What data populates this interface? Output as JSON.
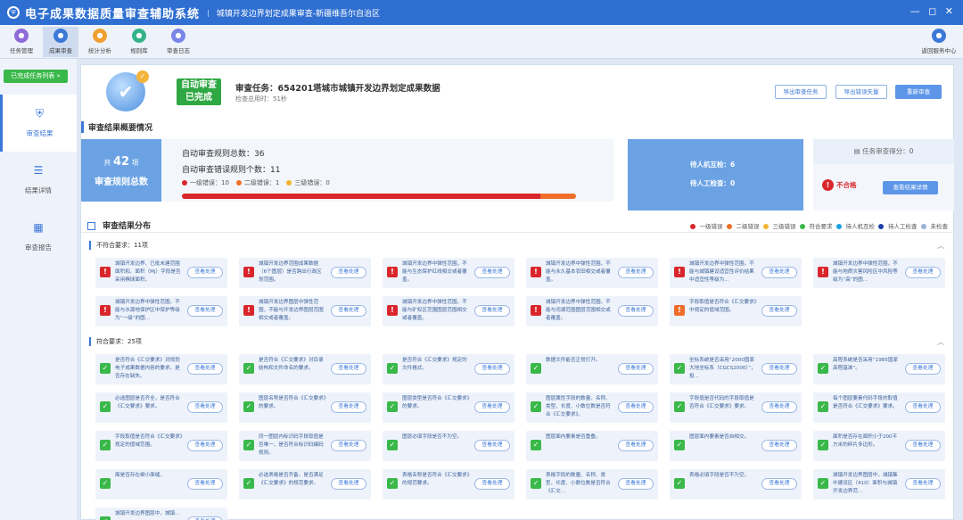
{
  "app": {
    "title": "电子成果数据质量审查辅助系统",
    "separator": "|",
    "subtitle": "城镇开发边界划定成果审查-新疆维吾尔自治区",
    "window_controls": "— ◻ ✕"
  },
  "toolbar": {
    "items": [
      {
        "label": "任务管理",
        "icon": "task-icon",
        "color": "#8e6bd8"
      },
      {
        "label": "成果审查",
        "icon": "review-icon",
        "color": "#3b78d8"
      },
      {
        "label": "统计分析",
        "icon": "stats-icon",
        "color": "#f0a030"
      },
      {
        "label": "规则库",
        "icon": "rules-icon",
        "color": "#34b38a"
      },
      {
        "label": "审查日志",
        "icon": "log-icon",
        "color": "#7a85e8"
      }
    ],
    "right_label": "返回服务中心",
    "active_index": 1
  },
  "sidebar": {
    "back_button": "已完成任务列表 »",
    "items": [
      {
        "label": "审查结果",
        "icon": "shield-icon"
      },
      {
        "label": "结果详情",
        "icon": "list-icon"
      },
      {
        "label": "审查报告",
        "icon": "report-icon"
      }
    ],
    "active_index": 0
  },
  "header": {
    "status_line1": "自动审查",
    "status_line2": "已完成",
    "task_label": "审查任务：",
    "task_name": "654201塔城市城镇开发边界划定成果数据",
    "elapsed": "检查总用时：51秒",
    "buttons": [
      "导出审查任务",
      "导出错误矢量",
      "重新审查"
    ]
  },
  "summary": {
    "section_title": "审查结果概要情况",
    "total_prefix": "共",
    "total_count": "42",
    "total_unit": "项",
    "total_label": "审查规则总数",
    "auto_rules_label": "自动审查规则总数：",
    "auto_rules_count": "36",
    "error_rules_label": "自动审查错误规则个数：",
    "error_rules_count": "11",
    "levels": [
      {
        "label": "一级错误：",
        "count": "10",
        "color": "#d9262c"
      },
      {
        "label": "二级错误：",
        "count": "1",
        "color": "#f06e2a"
      },
      {
        "label": "三级错误：",
        "count": "0",
        "color": "#f2b430"
      }
    ],
    "bar_fraction": {
      "level1": 0.91,
      "level2": 0.09
    },
    "machine_check_label": "待人机互检：",
    "machine_check_value": "6",
    "manual_check_label": "待人工检查：",
    "manual_check_value": "0",
    "score_label": "任务审查得分：",
    "score_value": "0",
    "result": "不合格",
    "detail_button": "查看结果详情"
  },
  "distribution": {
    "title": "审查结果分布",
    "legend": [
      {
        "label": "一级错误",
        "color": "#d9262c"
      },
      {
        "label": "二级错误",
        "color": "#f06e2a"
      },
      {
        "label": "三级错误",
        "color": "#f2b430"
      },
      {
        "label": "符合要求",
        "color": "#3ab84a"
      },
      {
        "label": "待人机互检",
        "color": "#1aa0e0"
      },
      {
        "label": "待人工检查",
        "color": "#1b3ea6"
      },
      {
        "label": "未检查",
        "color": "#9bb3d6"
      }
    ],
    "group_fail": "不符合要求：11项",
    "group_pass": "符合要求：25项",
    "check_button": "查看处理",
    "fail_cards": [
      {
        "text": "城镇开发边界、已批未建范围面积和、面积（Mj）字段是否采用椭球面积。",
        "color": "#d9262c"
      },
      {
        "text": "城镇开发边界范围成果数据（6个图层）是否跨出行政区划范围。",
        "color": "#d9262c"
      },
      {
        "text": "城镇开发边界中弹性范围，不能与生态保护红线相交或者覆盖。",
        "color": "#d9262c"
      },
      {
        "text": "城镇开发边界中弹性范围，不能与永久基本农田相交或者覆盖。",
        "color": "#d9262c"
      },
      {
        "text": "城镇开发边界中弹性范围，不能与城镇建设适宜性评价结果中适宜性等级为...",
        "color": "#d9262c"
      },
      {
        "text": "城镇开发边界中弹性范围，不能与地质灾害风险区中风险等级为“高”的图...",
        "color": "#d9262c"
      },
      {
        "text": "城镇开发边界中弹性范围，不能与水源地保护区中保护等级为“一级”的图...",
        "color": "#d9262c"
      },
      {
        "text": "城镇开发边界图层中弹性范围，不能与开发边界图层范围相交或者覆盖。",
        "color": "#d9262c"
      },
      {
        "text": "城镇开发边界中弹性范围，不能与矿权区范围图层范围相交或者覆盖。",
        "color": "#d9262c"
      },
      {
        "text": "城镇开发边界中弹性范围，不能与河湖范围图层范围相交或者覆盖。",
        "color": "#d9262c"
      },
      {
        "text": "字段取值是否符合《汇交要求》中规定的值域范围。",
        "color": "#f06e2a"
      }
    ],
    "pass_cards": [
      "是否符合《汇交要求》对规划电子成果数据内容的要求，是否存在缺失。",
      "是否符合《汇交要求》对目录结构和文件命名的要求。",
      "是否符合《汇交要求》规定的文件格式。",
      "数据文件能否正常打开。",
      "坐标系统是否采用“2000国家大地坐标系（CGCS2000）”，投...",
      "高程系统是否采用“1985国家高程基准”。",
      "必选图层是否齐全，是否符合《汇交要求》要求。",
      "图层名称是否符合《汇交要求》的要求。",
      "图层类型是否符合《汇交要求》的要求。",
      "图层属性字段的数量、名称、类型、长度、小数位数是否符合《汇交要求》。",
      "字段值是否代码的字段取值是否符合《汇交要求》要求。",
      "每个图层要素代码字段的取值是否符合《汇交要求》要求。",
      "字段取值是否符合《汇交要求》规定的值域范围。",
      "同一图层内标识码字段取值是否唯一，是否符合标识码编码规则。",
      "图层必填字段是否不为空。",
      "图层面内要素是否重叠。",
      "图层面内要素是否自相交。",
      "面积是否存在面积小于200平方米的碎片多边形。",
      "面是否存在细小面缝。",
      "必选表格是否齐备，是否满足《汇交要求》的规范要求。",
      "表格名称是否符合《汇交要求》的规范要求。",
      "表格字段的数量、名称、类型、长度、小数位数是否符合《汇交...",
      "表格必填字段是否不为空。",
      "城镇开发边界图层中，城镇集中建设区（410）面积与城镇开发边界范...",
      "城镇开发边界图层中，城镇..."
    ]
  }
}
